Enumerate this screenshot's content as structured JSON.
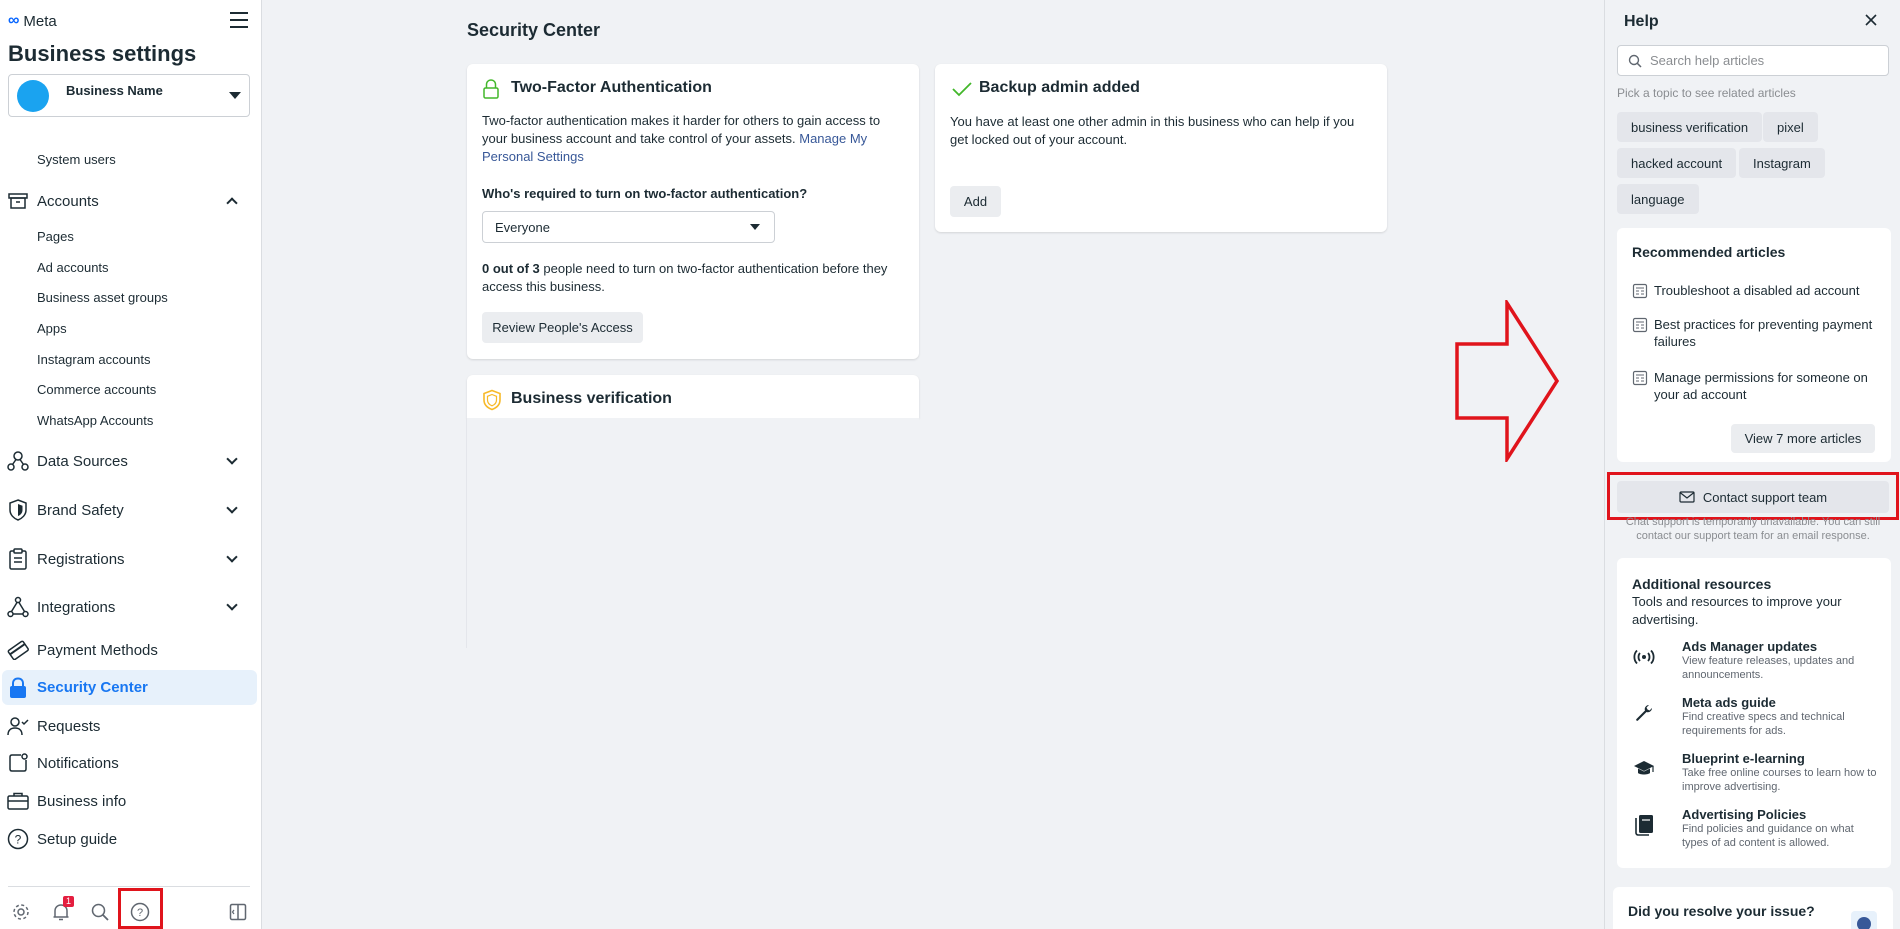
{
  "sidebar": {
    "brand": "Meta",
    "title": "Business settings",
    "business_name": "Business Name",
    "items": [
      {
        "label": "System users"
      },
      {
        "label": "Accounts"
      },
      {
        "label": "Pages"
      },
      {
        "label": "Ad accounts"
      },
      {
        "label": "Business asset groups"
      },
      {
        "label": "Apps"
      },
      {
        "label": "Instagram accounts"
      },
      {
        "label": "Commerce accounts"
      },
      {
        "label": "WhatsApp Accounts"
      },
      {
        "label": "Data Sources"
      },
      {
        "label": "Brand Safety"
      },
      {
        "label": "Registrations"
      },
      {
        "label": "Integrations"
      },
      {
        "label": "Payment Methods"
      },
      {
        "label": "Security Center"
      },
      {
        "label": "Requests"
      },
      {
        "label": "Notifications"
      },
      {
        "label": "Business info"
      },
      {
        "label": "Setup guide"
      }
    ],
    "notification_count": "1",
    "accent_color": "#1877f2"
  },
  "main": {
    "title": "Security Center",
    "two_factor": {
      "title": "Two-Factor Authentication",
      "description": "Two-factor authentication makes it harder for others to gain access to your business account and take control of your assets.",
      "link": "Manage My Personal Settings",
      "question": "Who's required to turn on two-factor authentication?",
      "selected": "Everyone",
      "count_bold": "0 out of 3",
      "count_text": "people need to turn on two-factor authentication before they access this business.",
      "review_button": "Review People's Access"
    },
    "backup_admin": {
      "title": "Backup admin added",
      "description": "You have at least one other admin in this business who can help if you get locked out of your account.",
      "add_button": "Add"
    },
    "verification": {
      "title": "Business verification"
    }
  },
  "help": {
    "title": "Help",
    "search_placeholder": "Search help articles",
    "topic_hint": "Pick a topic to see related articles",
    "topics": [
      "business verification",
      "pixel",
      "hacked account",
      "Instagram",
      "language"
    ],
    "recommended_title": "Recommended articles",
    "articles": [
      "Troubleshoot a disabled ad account",
      "Best practices for preventing payment failures",
      "Manage permissions for someone on your ad account"
    ],
    "view_more": "View 7 more articles",
    "contact": "Contact support team",
    "chat_note": "Chat support is temporarily unavailable. You can still contact our support team for an email response.",
    "resources_title": "Additional resources",
    "resources_subtitle": "Tools and resources to improve your advertising.",
    "resources": [
      {
        "title": "Ads Manager updates",
        "desc": "View feature releases, updates and announcements."
      },
      {
        "title": "Meta ads guide",
        "desc": "Find creative specs and technical requirements for ads."
      },
      {
        "title": "Blueprint e-learning",
        "desc": "Take free online courses to learn how to improve advertising."
      },
      {
        "title": "Advertising Policies",
        "desc": "Find policies and guidance on what types of ad content is allowed."
      }
    ],
    "resolve_question": "Did you resolve your issue?"
  },
  "colors": {
    "highlight_red": "#e0141c",
    "success_green": "#42b72a"
  }
}
